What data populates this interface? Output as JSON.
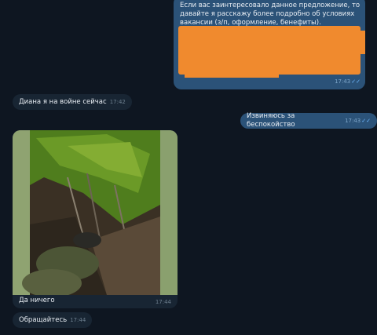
{
  "messages": {
    "m1": {
      "text": "Если вас заинтересовало данное предложение, то давайте я расскажу более подробно об условиях вакансии (з/п, оформление, бенефиты).",
      "time": "17:43",
      "status": "read"
    },
    "m2": {
      "text": "Диана я на войне сейчас",
      "time": "17:42"
    },
    "m3": {
      "text": "Извиняюсь за беспокойство",
      "time": "17:43",
      "status": "read"
    },
    "m4": {
      "caption": "Да ничего",
      "time": "17:44"
    },
    "m5": {
      "text": "Обращайтесь",
      "time": "17:44"
    }
  },
  "colors": {
    "background": "#0e1621",
    "outgoing_bubble": "#2b5278",
    "incoming_bubble": "#182533",
    "redaction": "#f08a2e"
  },
  "icons": {
    "read_receipt": "double-check-icon"
  }
}
